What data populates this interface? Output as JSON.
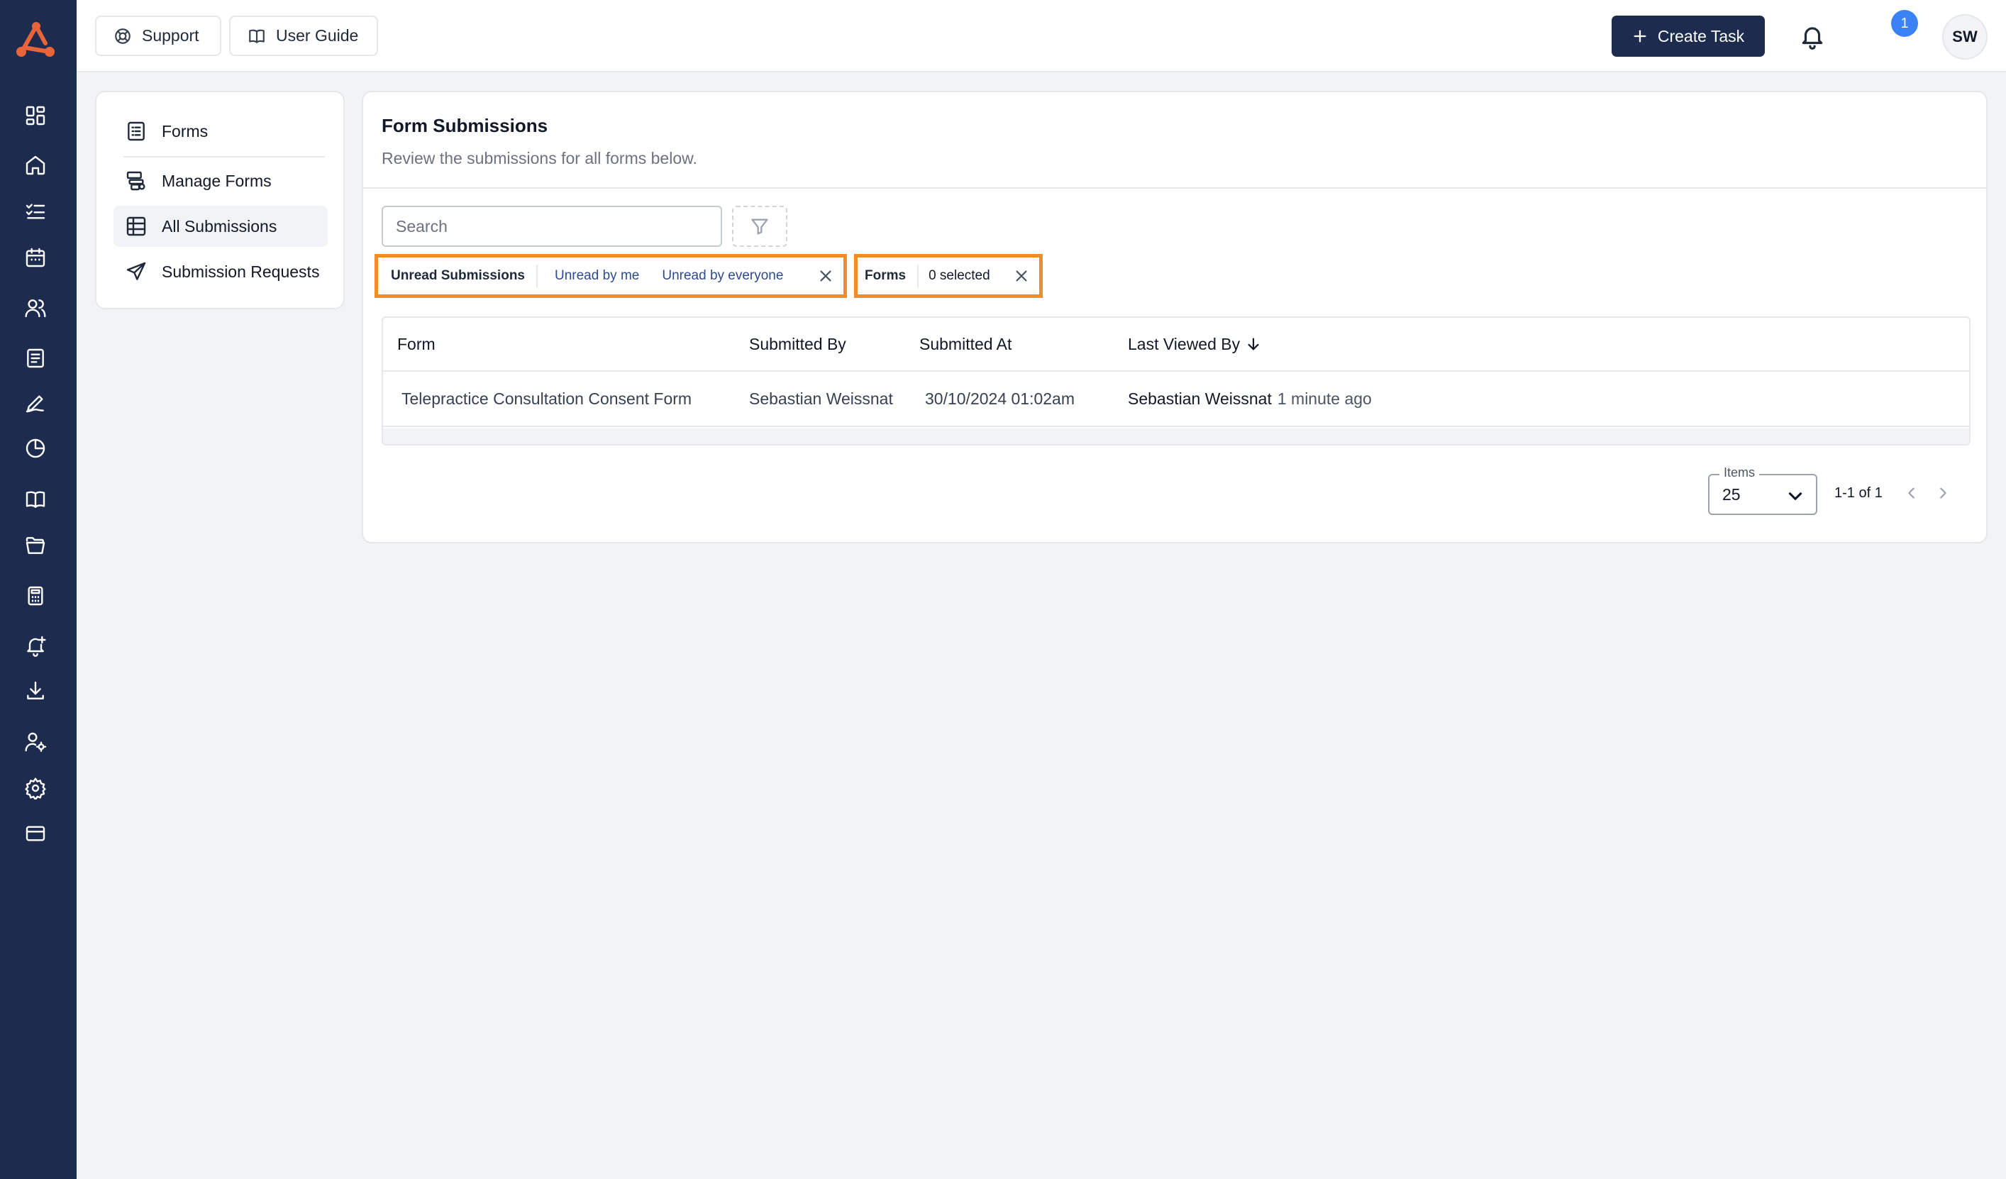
{
  "rail": {
    "icons": [
      "dashboard-icon",
      "home-icon",
      "task-list-icon",
      "calendar-icon",
      "users-icon",
      "forms-icon",
      "signature-icon",
      "reports-pie-icon",
      "user-guide-book-icon",
      "folder-icon",
      "calculator-icon",
      "bell-plus-icon",
      "download-icon",
      "user-settings-icon",
      "gear-icon",
      "credit-card-icon"
    ]
  },
  "topbar": {
    "support_label": "Support",
    "user_guide_label": "User Guide",
    "create_task_label": "Create Task",
    "notification_count": "1",
    "avatar_initials": "SW"
  },
  "subnav": {
    "items": [
      {
        "label": "Forms",
        "icon": "form-list-icon"
      },
      {
        "label": "Manage Forms",
        "icon": "manage-forms-icon"
      },
      {
        "label": "All Submissions",
        "icon": "table-grid-icon",
        "active": true
      },
      {
        "label": "Submission Requests",
        "icon": "send-icon"
      }
    ]
  },
  "main": {
    "title": "Form Submissions",
    "subtitle": "Review the submissions for all forms below.",
    "search_placeholder": "Search",
    "filters": {
      "unread": {
        "label": "Unread Submissions",
        "options": [
          "Unread by me",
          "Unread by everyone"
        ]
      },
      "forms": {
        "label": "Forms",
        "value": "0 selected"
      }
    },
    "table": {
      "columns": [
        "Form",
        "Submitted By",
        "Submitted At",
        "Last Viewed By"
      ],
      "sorted_column": "Last Viewed By",
      "sort_direction": "descending",
      "rows": [
        {
          "form": "Telepractice Consultation Consent Form",
          "submitted_by": "Sebastian Weissnat",
          "submitted_at": "30/10/2024 01:02am",
          "last_viewed_by": "Sebastian Weissnat",
          "last_viewed_time": "1 minute ago"
        }
      ]
    },
    "pagination": {
      "items_label": "Items",
      "items_per_page": "25",
      "range_text": "1-1 of 1"
    }
  },
  "colors": {
    "rail_bg": "#1d2b4f",
    "primary_button": "#1d2b4f",
    "highlight_border": "#f28c28",
    "badge": "#3b82f6",
    "filter_option_text": "#2f4a8a"
  }
}
